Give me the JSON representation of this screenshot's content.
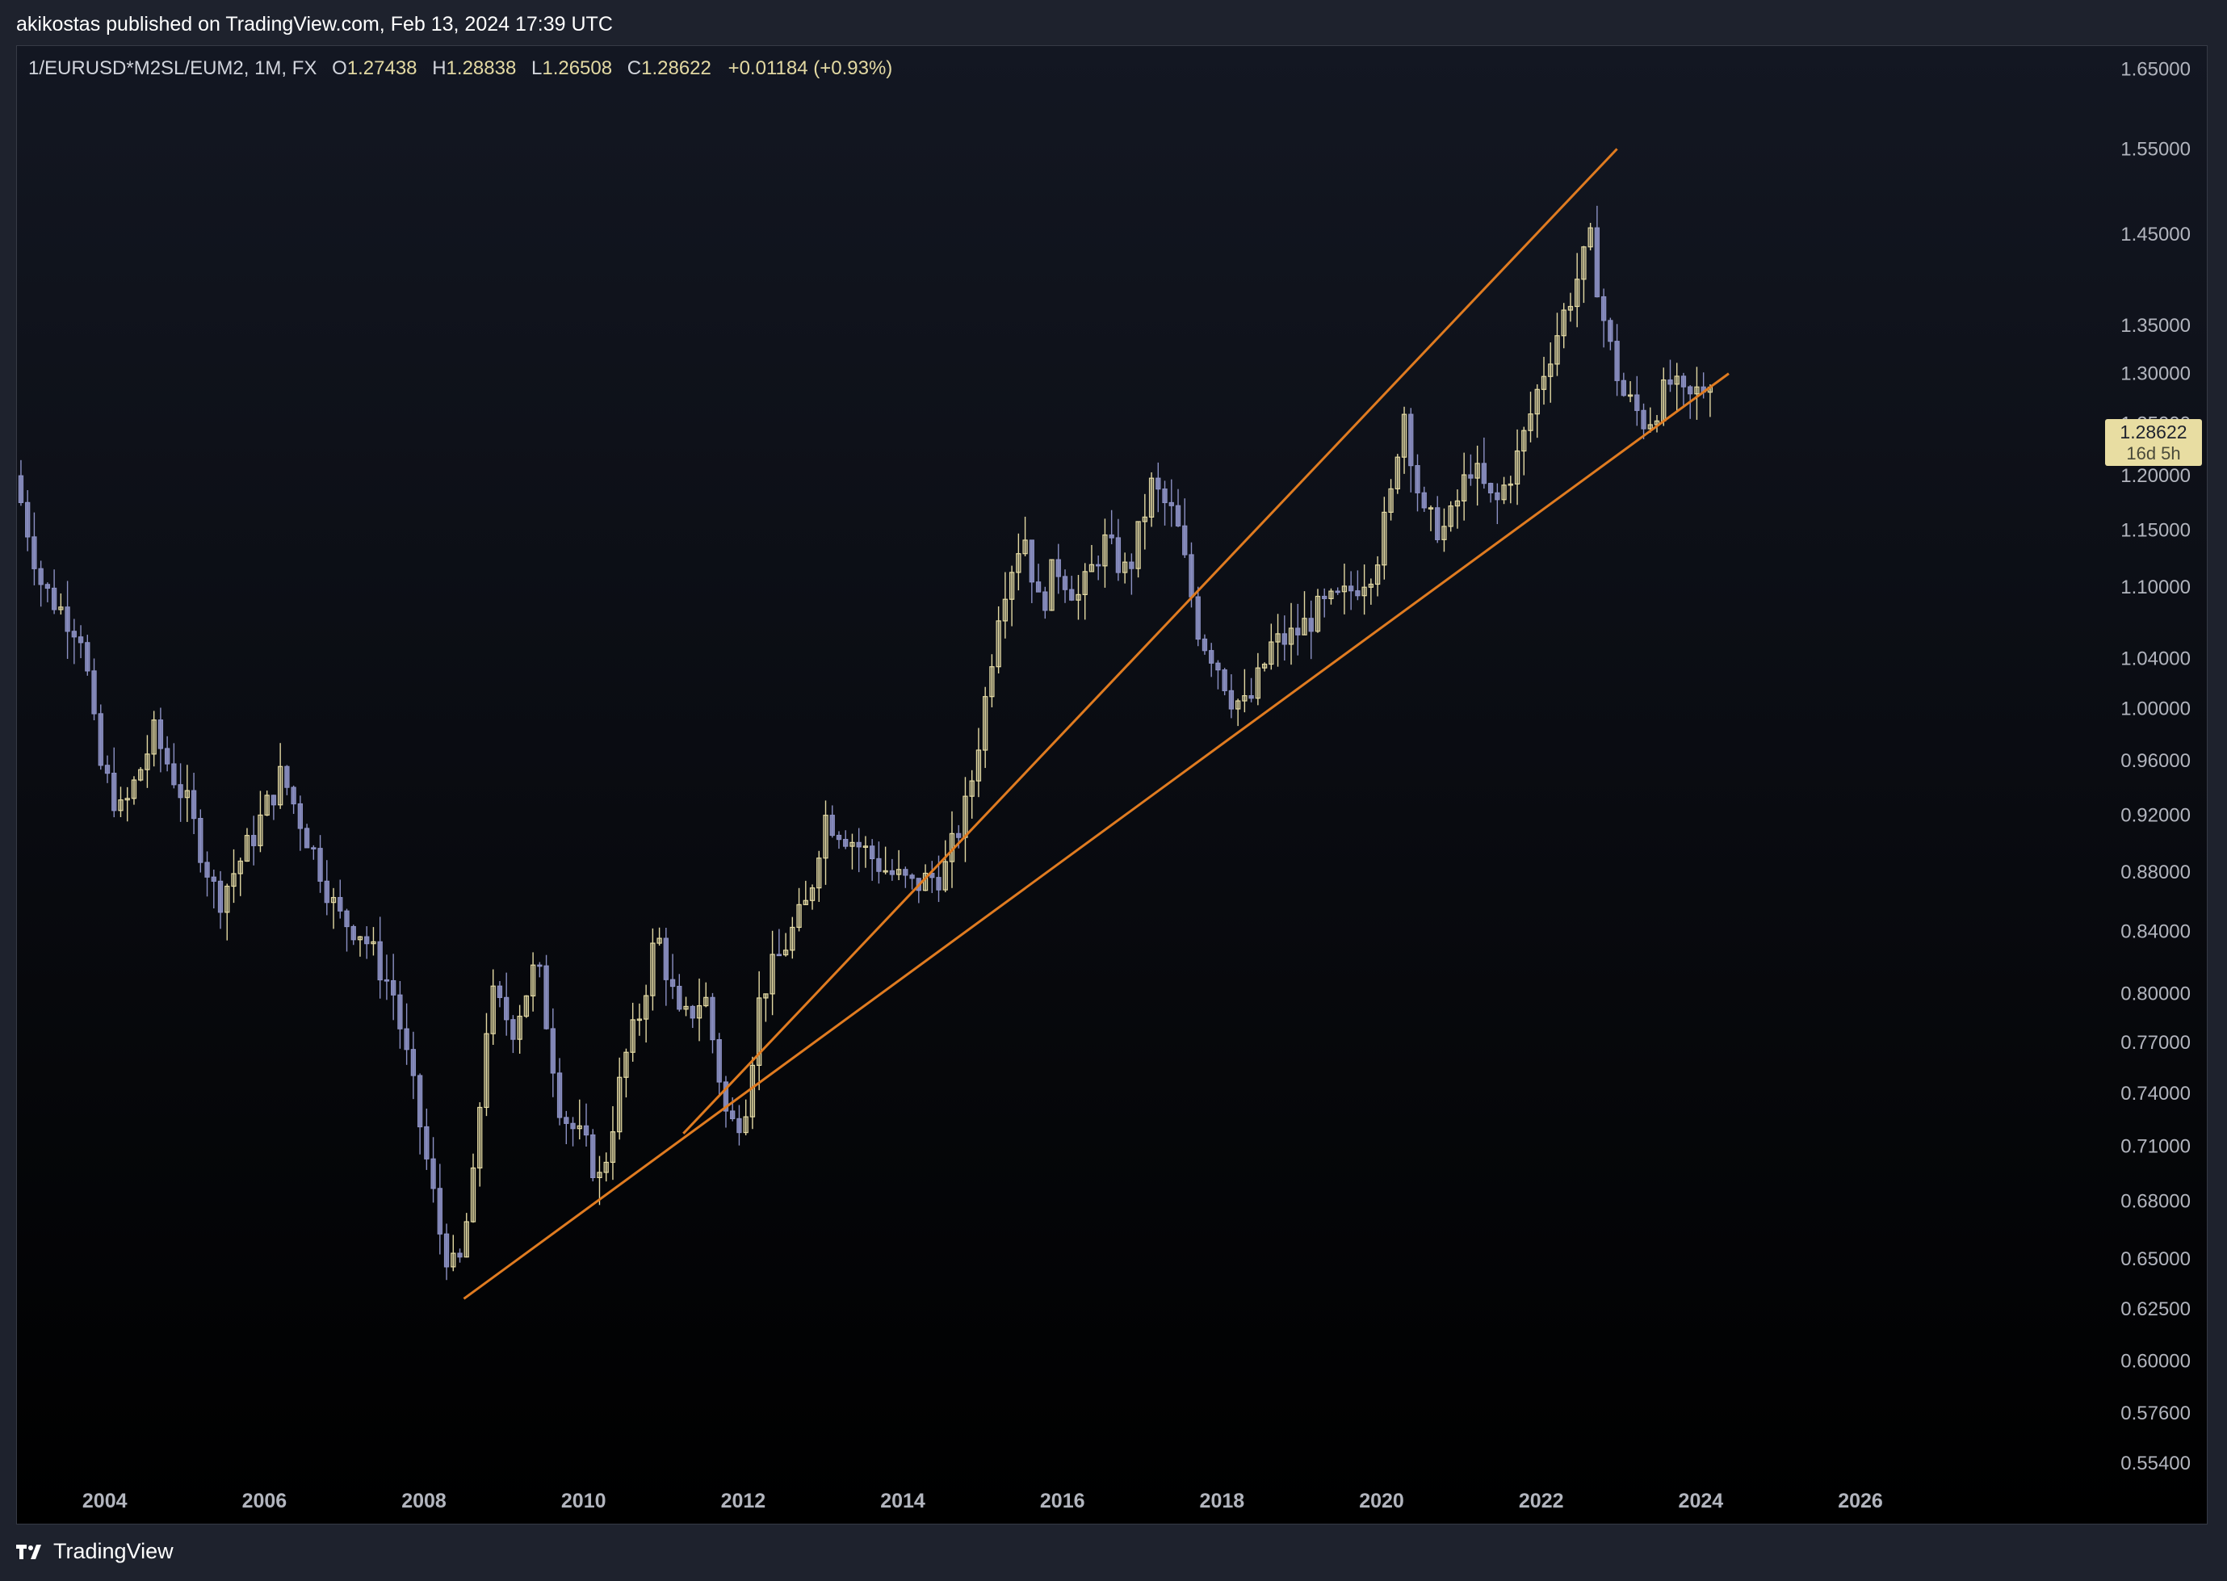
{
  "header": {
    "published": "akikostas published on TradingView.com, Feb 13, 2024 17:39 UTC"
  },
  "legend": {
    "symbol": "1/EURUSD*M2SL/EUM2, 1M, FX",
    "o_label": "O",
    "o": "1.27438",
    "h_label": "H",
    "h": "1.28838",
    "l_label": "L",
    "l": "1.26508",
    "c_label": "C",
    "c": "1.28622",
    "change": "+0.01184 (+0.93%)"
  },
  "price_tag": {
    "price": "1.28622",
    "countdown": "16d 5h"
  },
  "footer": {
    "brand": "TradingView"
  },
  "colors": {
    "background_top": "#131722",
    "background_bottom": "#000000",
    "up_candle": "#e3d9a3",
    "down_candle": "#8c91c4",
    "trendline": "#e07b20",
    "axis_text": "#b2b5be"
  },
  "chart_data": {
    "type": "candlestick",
    "interval": "1M",
    "x_ticks": [
      "2004",
      "2006",
      "2008",
      "2010",
      "2012",
      "2014",
      "2016",
      "2018",
      "2020",
      "2022",
      "2024",
      "2026"
    ],
    "y_ticks": [
      "0.55400",
      "0.57600",
      "0.60000",
      "0.62500",
      "0.65000",
      "0.68000",
      "0.71000",
      "0.74000",
      "0.77000",
      "0.80000",
      "0.84000",
      "0.88000",
      "0.92000",
      "0.96000",
      "1.00000",
      "1.04000",
      "1.10000",
      "1.15000",
      "1.20000",
      "1.25000",
      "1.30000",
      "1.35000",
      "1.45000",
      "1.55000",
      "1.65000"
    ],
    "y_scale": "log",
    "xlim": [
      2002.9,
      2028.6
    ],
    "ylim": [
      0.535,
      1.68
    ],
    "path": [
      [
        2002.95,
        1.2
      ],
      [
        2003.3,
        1.1
      ],
      [
        2003.8,
        1.06
      ],
      [
        2004.0,
        0.96
      ],
      [
        2004.3,
        0.92
      ],
      [
        2004.7,
        0.98
      ],
      [
        2005.1,
        0.93
      ],
      [
        2005.5,
        0.86
      ],
      [
        2005.9,
        0.9
      ],
      [
        2006.3,
        0.95
      ],
      [
        2006.8,
        0.88
      ],
      [
        2007.0,
        0.85
      ],
      [
        2007.3,
        0.84
      ],
      [
        2007.7,
        0.8
      ],
      [
        2008.0,
        0.73
      ],
      [
        2008.3,
        0.66
      ],
      [
        2008.5,
        0.64
      ],
      [
        2008.7,
        0.69
      ],
      [
        2008.9,
        0.8
      ],
      [
        2009.2,
        0.78
      ],
      [
        2009.5,
        0.82
      ],
      [
        2009.8,
        0.73
      ],
      [
        2010.1,
        0.71
      ],
      [
        2010.3,
        0.69
      ],
      [
        2010.6,
        0.76
      ],
      [
        2010.8,
        0.79
      ],
      [
        2011.0,
        0.84
      ],
      [
        2011.3,
        0.78
      ],
      [
        2011.6,
        0.8
      ],
      [
        2011.9,
        0.72
      ],
      [
        2012.1,
        0.73
      ],
      [
        2012.3,
        0.8
      ],
      [
        2012.6,
        0.83
      ],
      [
        2012.9,
        0.86
      ],
      [
        2013.1,
        0.92
      ],
      [
        2013.5,
        0.9
      ],
      [
        2013.9,
        0.88
      ],
      [
        2014.2,
        0.87
      ],
      [
        2014.6,
        0.88
      ],
      [
        2014.9,
        0.93
      ],
      [
        2015.1,
        1.0
      ],
      [
        2015.3,
        1.09
      ],
      [
        2015.6,
        1.15
      ],
      [
        2015.8,
        1.08
      ],
      [
        2016.0,
        1.12
      ],
      [
        2016.3,
        1.09
      ],
      [
        2016.6,
        1.14
      ],
      [
        2016.9,
        1.11
      ],
      [
        2017.2,
        1.19
      ],
      [
        2017.5,
        1.16
      ],
      [
        2017.8,
        1.06
      ],
      [
        2018.0,
        1.04
      ],
      [
        2018.2,
        1.01
      ],
      [
        2018.4,
        1.0
      ],
      [
        2018.7,
        1.05
      ],
      [
        2019.0,
        1.06
      ],
      [
        2019.3,
        1.08
      ],
      [
        2019.6,
        1.09
      ],
      [
        2020.0,
        1.12
      ],
      [
        2020.2,
        1.18
      ],
      [
        2020.35,
        1.27
      ],
      [
        2020.6,
        1.16
      ],
      [
        2020.9,
        1.15
      ],
      [
        2021.2,
        1.21
      ],
      [
        2021.5,
        1.17
      ],
      [
        2021.8,
        1.22
      ],
      [
        2022.1,
        1.3
      ],
      [
        2022.4,
        1.37
      ],
      [
        2022.7,
        1.44
      ],
      [
        2022.9,
        1.34
      ],
      [
        2023.1,
        1.28
      ],
      [
        2023.4,
        1.25
      ],
      [
        2023.7,
        1.29
      ],
      [
        2023.9,
        1.27
      ],
      [
        2024.1,
        1.286
      ]
    ],
    "last_close": 1.28622,
    "trendlines": [
      {
        "x": [
          2008.5,
          2024.35
        ],
        "y": [
          0.63,
          1.3
        ]
      },
      {
        "x": [
          2011.25,
          2022.95
        ],
        "y": [
          0.717,
          1.55
        ]
      }
    ]
  }
}
